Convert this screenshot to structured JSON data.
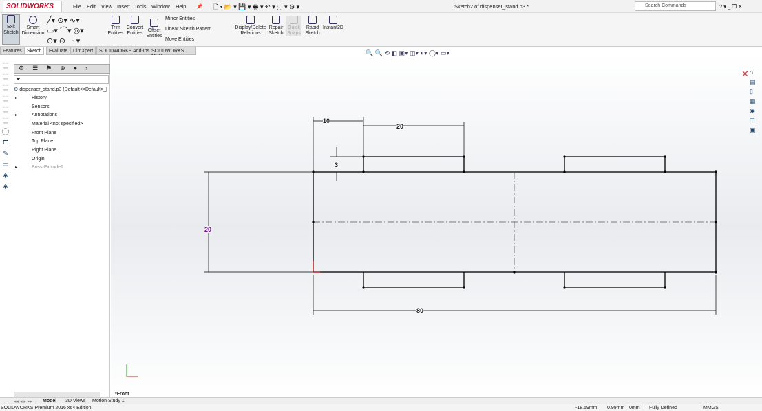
{
  "app": {
    "logo": "SOLIDWORKS",
    "title": "Sketch2 of dispenser_stand.p3 *",
    "search_placeholder": "Search Commands"
  },
  "menu": [
    "File",
    "Edit",
    "View",
    "Insert",
    "Tools",
    "Window",
    "Help"
  ],
  "ribbon": {
    "exit_sketch": "Exit Sketch",
    "smart_dimension": "Smart Dimension",
    "trim": "Trim Entities",
    "convert": "Convert Entities",
    "offset": "Offset Entities",
    "mirror": "Mirror Entities",
    "linear_pattern": "Linear Sketch Pattern",
    "move": "Move Entities",
    "display_relations": "Display/Delete Relations",
    "repair": "Repair Sketch",
    "quick_snaps": "Quick Snaps",
    "rapid": "Rapid Sketch",
    "instant2d": "Instant2D"
  },
  "tabs": [
    "Features",
    "Sketch",
    "Evaluate",
    "DimXpert",
    "SOLIDWORKS Add-Ins",
    "SOLIDWORKS MBD"
  ],
  "tree": {
    "root": "dispenser_stand.p3  (Default<<Default>_[",
    "items": [
      "History",
      "Sensors",
      "Annotations",
      "Material <not specified>",
      "Front Plane",
      "Top Plane",
      "Right Plane",
      "Origin",
      "Boss-Extrude1"
    ]
  },
  "dims": {
    "d10": "10",
    "d20top": "20",
    "d3": "3",
    "d20v": "20",
    "d80": "80"
  },
  "view_label": "*Front",
  "bottom_tabs": [
    "Model",
    "3D Views",
    "Motion Study 1"
  ],
  "status": {
    "edition": "SOLIDWORKS Premium 2016 x64 Edition",
    "x": "-18.59mm",
    "y": "0.99mm",
    "z": "0mm",
    "state": "Fully Defined",
    "units": "MMGS"
  },
  "colors": {
    "dim_driven": "#7a0a9a",
    "accent": "#c8102e"
  }
}
